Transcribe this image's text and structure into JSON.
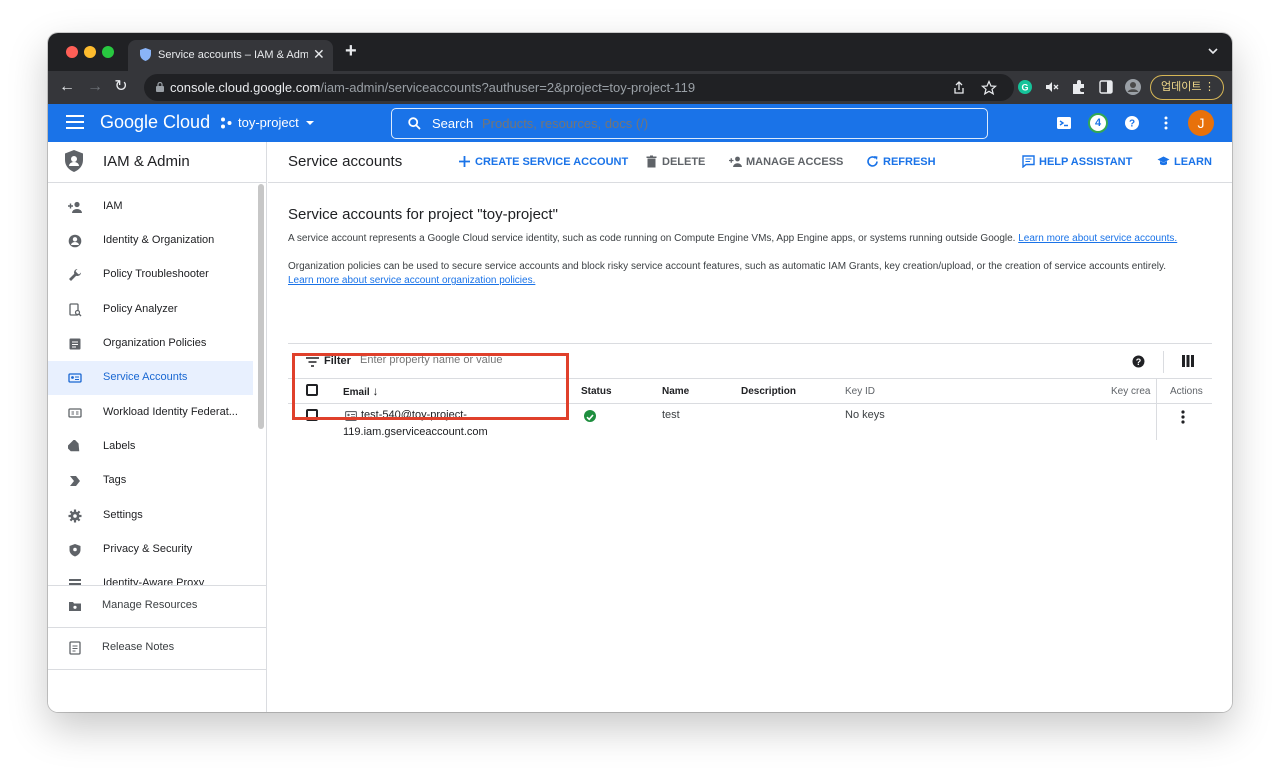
{
  "browser": {
    "tab_title": "Service accounts – IAM & Admin",
    "tab_close": "✕",
    "new_tab": "+",
    "url_host": "console.cloud.google.com",
    "url_path": "/iam-admin/serviceaccounts?authuser=2&project=toy-project-119",
    "update_label": "업데이트",
    "update_dots": "⋮"
  },
  "header": {
    "logo": "Google Cloud",
    "project": "toy-project",
    "search_label": "Search",
    "search_placeholder": "Products, resources, docs (/)",
    "notification_count": "4",
    "avatar_letter": "J"
  },
  "sidebar": {
    "title": "IAM & Admin",
    "items": [
      {
        "label": "IAM",
        "icon": "person-add-icon"
      },
      {
        "label": "Identity & Organization",
        "icon": "account-circle-icon"
      },
      {
        "label": "Policy Troubleshooter",
        "icon": "wrench-icon"
      },
      {
        "label": "Policy Analyzer",
        "icon": "document-search-icon"
      },
      {
        "label": "Organization Policies",
        "icon": "list-document-icon"
      },
      {
        "label": "Service Accounts",
        "icon": "service-account-icon",
        "active": true
      },
      {
        "label": "Workload Identity Federat...",
        "icon": "id-card-icon"
      },
      {
        "label": "Labels",
        "icon": "label-icon"
      },
      {
        "label": "Tags",
        "icon": "tag-arrow-icon"
      },
      {
        "label": "Settings",
        "icon": "gear-icon"
      },
      {
        "label": "Privacy & Security",
        "icon": "shield-icon"
      },
      {
        "label": "Identity-Aware Proxy",
        "icon": "proxy-icon"
      }
    ],
    "manage_resources": "Manage Resources",
    "release_notes": "Release Notes",
    "collapse": "<I"
  },
  "toolbar": {
    "title": "Service accounts",
    "create": "CREATE SERVICE ACCOUNT",
    "delete": "DELETE",
    "manage_access": "MANAGE ACCESS",
    "refresh": "REFRESH",
    "help_assistant": "HELP ASSISTANT",
    "learn": "LEARN"
  },
  "content": {
    "section_title": "Service accounts for project \"toy-project\"",
    "desc1": "A service account represents a Google Cloud service identity, such as code running on Compute Engine VMs, App Engine apps, or systems running outside Google.",
    "desc1_link": "Learn more about service accounts.",
    "desc2": "Organization policies can be used to secure service accounts and block risky service account features, such as automatic IAM Grants, key creation/upload, or the creation of service accounts entirely.",
    "desc2_link": "Learn more about service account organization policies."
  },
  "filter": {
    "label": "Filter",
    "placeholder": "Enter property name or value"
  },
  "table": {
    "columns": {
      "email": "Email",
      "sort": "↓",
      "status": "Status",
      "name": "Name",
      "description": "Description",
      "key_id": "Key ID",
      "key_created": "Key crea",
      "actions": "Actions"
    },
    "rows": [
      {
        "email_line1": "test-540@toy-project-",
        "email_line2": "119.iam.gserviceaccount.com",
        "status": "enabled",
        "name": "test",
        "description": "",
        "key_id": "No keys",
        "key_created": ""
      }
    ]
  },
  "colors": {
    "brand_blue": "#1a73e8",
    "highlight_red": "#e0402b",
    "status_green": "#1e8e3e"
  }
}
